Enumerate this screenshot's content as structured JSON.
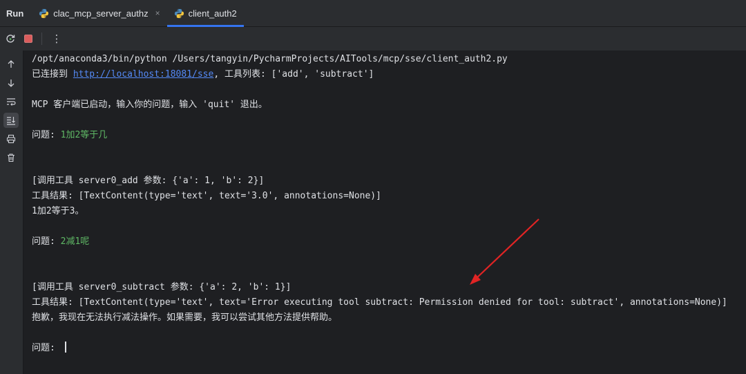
{
  "header": {
    "run_label": "Run",
    "tabs": [
      {
        "label": "clac_mcp_server_authz",
        "close": "×"
      },
      {
        "label": "client_auth2"
      }
    ]
  },
  "toolbar": {
    "more_icon": "⋮"
  },
  "console": {
    "l1": "/opt/anaconda3/bin/python /Users/tangyin/PycharmProjects/AITools/mcp/sse/client_auth2.py",
    "l2_prefix": "已连接到 ",
    "l2_link": "http://localhost:18081/sse",
    "l2_suffix": ", 工具列表: ['add', 'subtract']",
    "l3": "MCP 客户端已启动，输入你的问题，输入 'quit' 退出。",
    "q1_label": "问题: ",
    "q1_value": "1加2等于几",
    "call1": "[调用工具 server0_add 参数: {'a': 1, 'b': 2}]",
    "result1": "工具结果: [TextContent(type='text', text='3.0', annotations=None)]",
    "answer1": "1加2等于3。",
    "q2_label": "问题: ",
    "q2_value": "2减1呢",
    "call2": "[调用工具 server0_subtract 参数: {'a': 2, 'b': 1}]",
    "result2": "工具结果: [TextContent(type='text', text='Error executing tool subtract: Permission denied for tool: subtract', annotations=None)]",
    "answer2": "抱歉，我现在无法执行减法操作。如果需要，我可以尝试其他方法提供帮助。",
    "q3_label": "问题: "
  },
  "colors": {
    "accent": "#3574f0",
    "link": "#548af7",
    "user_input": "#5fb865",
    "annotation_arrow": "#e02424",
    "stop": "#db5c5c"
  }
}
